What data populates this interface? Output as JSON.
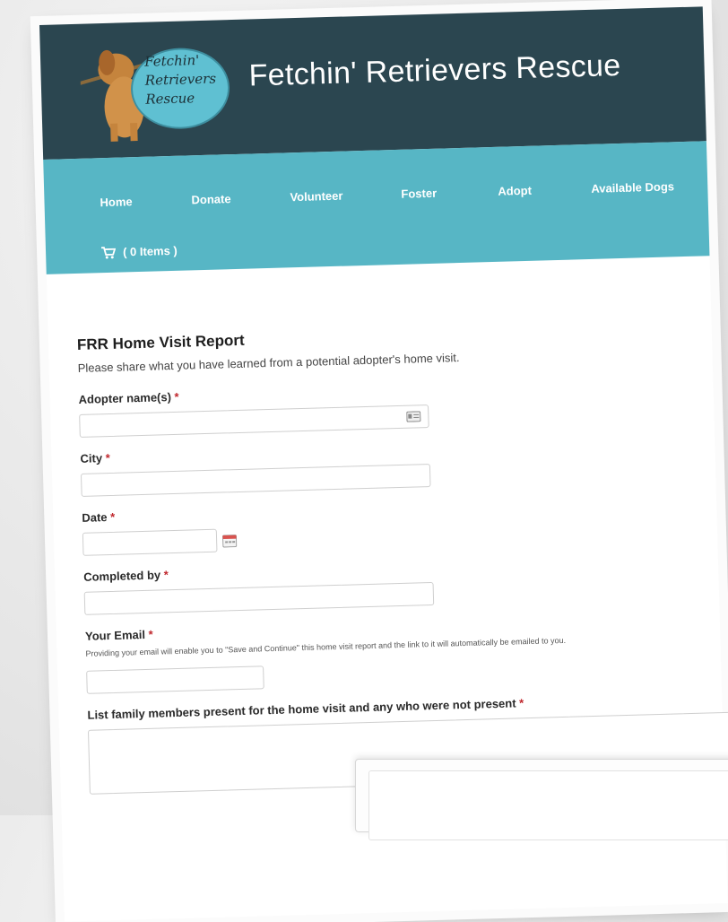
{
  "site": {
    "title": "Fetchin' Retrievers Rescue",
    "logo_lines": [
      "Fetchin'",
      "Retrievers",
      "Rescue"
    ]
  },
  "nav": {
    "items": [
      "Home",
      "Donate",
      "Volunteer",
      "Foster",
      "Adopt",
      "Available Dogs"
    ],
    "cart_label": "( 0 Items )"
  },
  "form": {
    "title": "FRR Home Visit Report",
    "intro": "Please share what you have learned from a potential adopter's home visit.",
    "required_mark": "*",
    "fields": {
      "adopter": {
        "label": "Adopter name(s)",
        "value": ""
      },
      "city": {
        "label": "City",
        "value": ""
      },
      "date": {
        "label": "Date",
        "value": ""
      },
      "completed_by": {
        "label": "Completed by",
        "value": ""
      },
      "email": {
        "label": "Your Email",
        "hint": "Providing your email will enable you to \"Save and Continue\" this home visit report and the link to it will automatically be emailed to you.",
        "value": ""
      },
      "family": {
        "label": "List family members present for the home visit and any who were not present",
        "value": ""
      }
    }
  },
  "colors": {
    "header_bg": "#2b4650",
    "nav_bg": "#57b6c5",
    "required": "#c0272d"
  },
  "icons": {
    "cart": "cart-icon",
    "contact_card": "contact-card-icon",
    "calendar": "calendar-icon"
  }
}
